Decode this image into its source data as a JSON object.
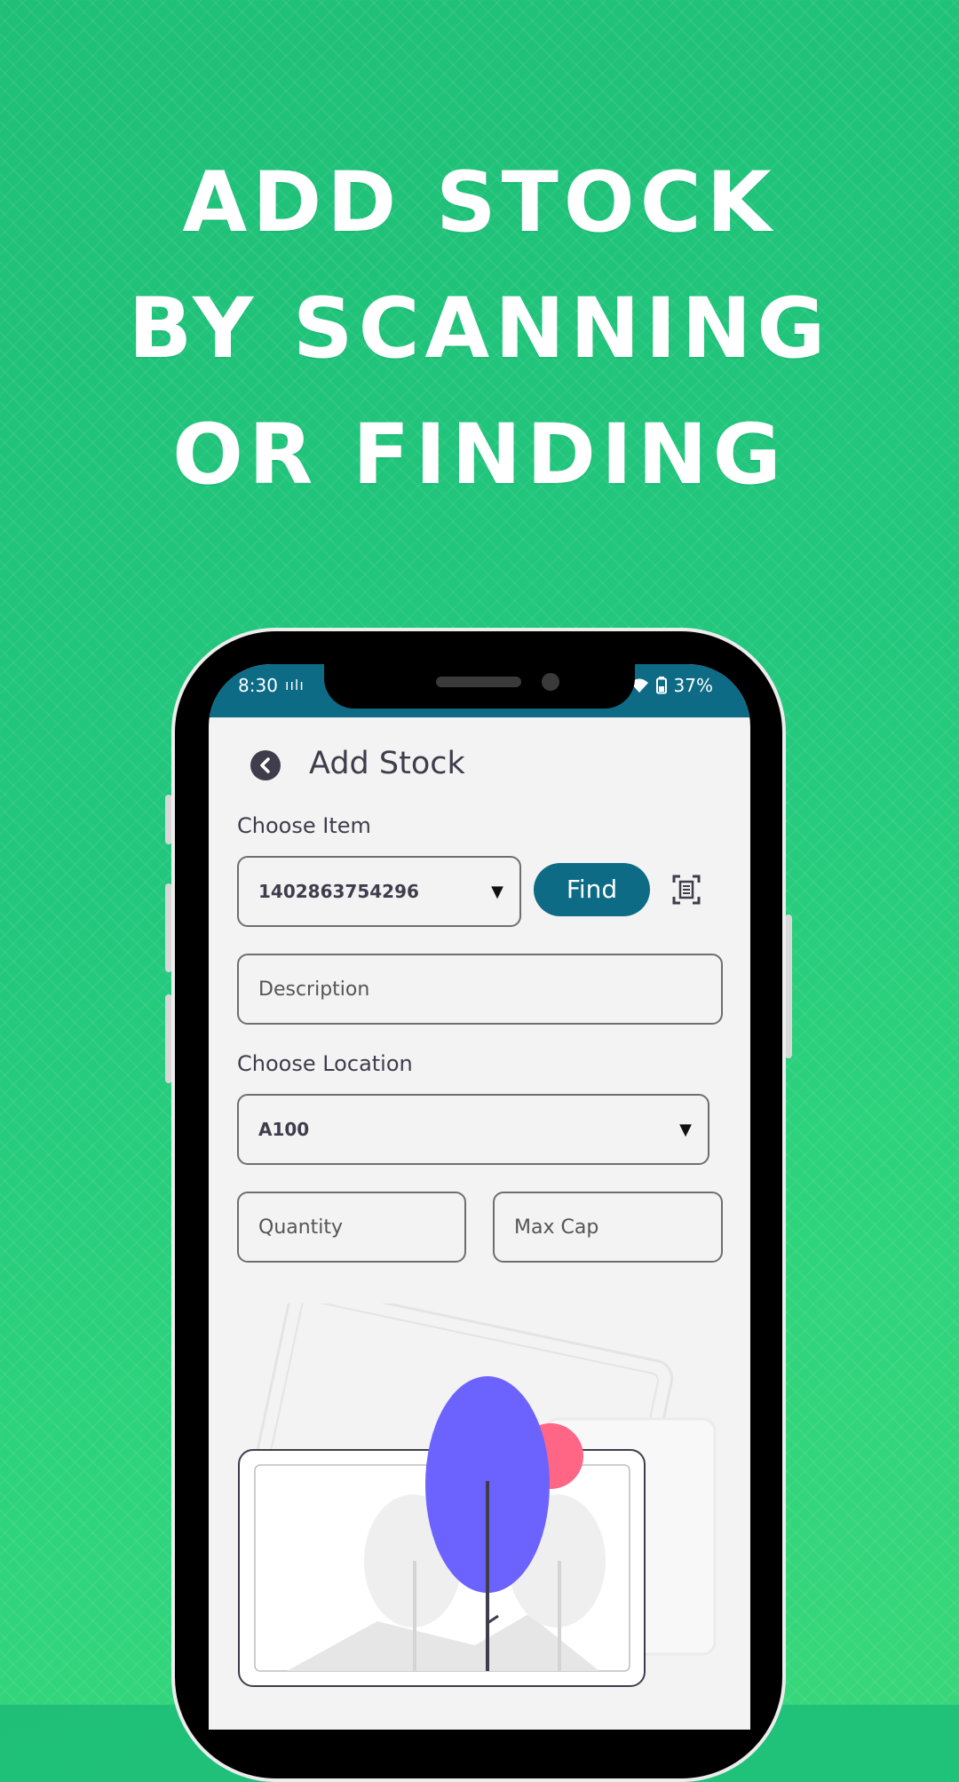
{
  "headline": {
    "line1": "ADD STOCK",
    "line2": "BY SCANNING",
    "line3": "OR FINDING"
  },
  "status_bar": {
    "time": "8:30",
    "indicator": "ıılı",
    "battery": "37%"
  },
  "header": {
    "title": "Add Stock",
    "back_icon": "chevron-left-icon"
  },
  "form": {
    "choose_item_label": "Choose Item",
    "item_value": "1402863754296",
    "find_label": "Find",
    "scan_icon": "barcode-scan-icon",
    "description_placeholder": "Description",
    "choose_location_label": "Choose Location",
    "location_value": "A100",
    "quantity_placeholder": "Quantity",
    "max_cap_placeholder": "Max Cap"
  },
  "colors": {
    "background": "#22c77d",
    "primary": "#0d6b86",
    "text": "#3f3d4c",
    "tree": "#6c63ff",
    "sun": "#ff6584"
  }
}
